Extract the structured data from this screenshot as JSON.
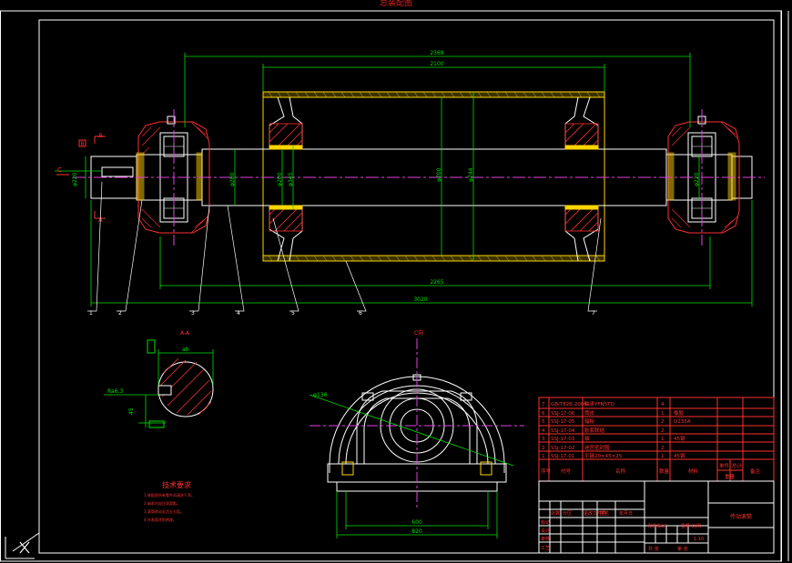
{
  "drawing": {
    "dimensions": {
      "overall_top": "2369",
      "drum_top": "2100",
      "drum_bottom": "2265",
      "overall_bottom": "3020",
      "diam_drum_outer": "φ744",
      "diam_drum_inner": "φ700",
      "diam_hub_left": "φ200",
      "diam_hub_left_2": "φ345",
      "diam_shaft_left": "φ280",
      "diam_shaft_end": "φ220",
      "diam_right_bearing": "φ220",
      "section_width": "ab",
      "section_roughness": "Ra6.3",
      "section_key": "45",
      "housing_diam": "φ136",
      "housing_width_1": "600",
      "housing_width_2": "820"
    },
    "labels": {
      "section_mark_top": "A",
      "section_mark_bottom": "A",
      "section_view_title": "A-A",
      "view_c": "C",
      "view_c_housing": "C向",
      "datum_box": "B",
      "tech_requirements_title": "技术要求",
      "top_title": "总装配图"
    },
    "callouts": [
      "1",
      "2",
      "3",
      "4",
      "5",
      "6",
      "7"
    ],
    "tech_notes": [
      "1.装配前所有零件须清洗干净。",
      "2.轴承内加注润滑脂。",
      "3.滚筒转动灵活无卡阻。",
      "4.外表面涂防锈漆。"
    ]
  },
  "parts_list": {
    "rows": [
      {
        "no": "7",
        "code": "GB/T826-2006",
        "name": "轴承YFN5TO",
        "qty": "4",
        "material": "",
        "note": ""
      },
      {
        "no": "6",
        "code": "SSJ-17-06",
        "name": "筒皮",
        "qty": "1",
        "material": "橡胶",
        "note": ""
      },
      {
        "no": "5",
        "code": "SSJ-17-05",
        "name": "辐板",
        "qty": "2",
        "material": "Q235A",
        "note": ""
      },
      {
        "no": "4",
        "code": "SSJ-17-04",
        "name": "胀套联结",
        "qty": "2",
        "material": "",
        "note": ""
      },
      {
        "no": "3",
        "code": "SSJ-17-03",
        "name": "轴",
        "qty": "1",
        "material": "45钢",
        "note": ""
      },
      {
        "no": "2",
        "code": "SSJ-17-02",
        "name": "迷宫密封圈",
        "qty": "2",
        "material": "",
        "note": ""
      },
      {
        "no": "1",
        "code": "SSJ-17-01",
        "name": "平键20×45×25",
        "qty": "1",
        "material": "45钢",
        "note": ""
      }
    ],
    "header": {
      "no": "序号",
      "code": "代号",
      "name": "名称",
      "qty": "数量",
      "material": "材料",
      "unit_weight": "单件",
      "total_weight": "总计",
      "weight": "重量",
      "note": "备注"
    }
  },
  "title_block": {
    "drawing_name": "传动滚筒",
    "stage_label": "阶段标记",
    "weight_label": "重量",
    "scale_label": "比例",
    "scale_value": "1:10",
    "sheet_label": "共 张",
    "sheet_of": "第 张",
    "rows": [
      "标记",
      "设计",
      "审核",
      "工艺"
    ],
    "cols": [
      "处数",
      "分区",
      "更改文件号",
      "签名",
      "年月日"
    ]
  }
}
